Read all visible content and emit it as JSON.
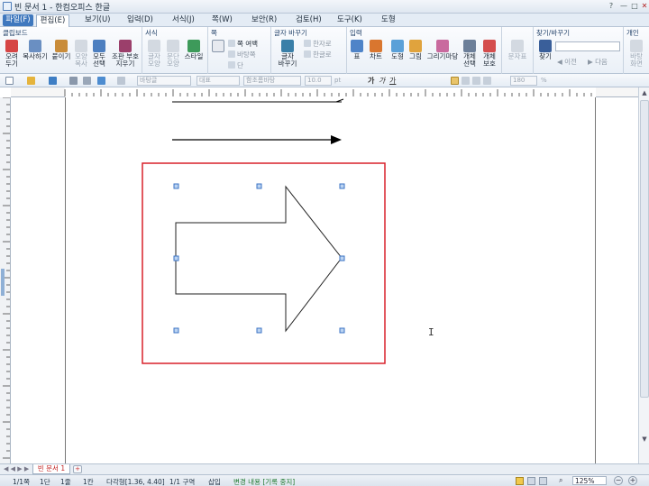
{
  "window": {
    "title": "빈 문서 1 - 한컴오피스 한글",
    "controls": {
      "help": "?",
      "minimize": "—",
      "maximize": "□",
      "close": "✕"
    }
  },
  "menubar": {
    "items": [
      "파일(F)",
      "편집(E)",
      "보기(U)",
      "입력(D)",
      "서식(J)",
      "쪽(W)",
      "보안(R)",
      "검토(H)",
      "도구(K)",
      "도형"
    ],
    "active": "편집(E)"
  },
  "ribbon": {
    "groups": {
      "clipboard": "클립보드",
      "format": "서식",
      "page": "쪽",
      "char_replace": "글자 바꾸기",
      "insert": "입력",
      "find": "찾기/바꾸기",
      "personal": "개인"
    },
    "clipboard_buttons": [
      "오려\n두기",
      "복사하기",
      "붙이기",
      "모양\n복사",
      "모두\n선택",
      "조판 부호\n지우기"
    ],
    "format_buttons": [
      "글자\n모양",
      "문단\n모양",
      "스타일"
    ],
    "page_items": [
      "쪽 여백",
      "바탕쪽",
      "단"
    ],
    "char_replace_buttons": [
      "글자\n바꾸기"
    ],
    "char_replace_items": [
      "한자로",
      "한글로"
    ],
    "insert_buttons": [
      "표",
      "차트",
      "도형",
      "그림",
      "그리기마당",
      "개체\n선택",
      "개체\n보호"
    ],
    "misc_buttons": [
      "문자표"
    ],
    "find_buttons": [
      "찾기"
    ],
    "find_nav": [
      "이전",
      "다음"
    ],
    "personal_buttons": [
      "바탕\n화면"
    ]
  },
  "toolbar": {
    "style": "바탕글",
    "language": "대표",
    "font": "함초롬바탕",
    "font_size": "10.0",
    "size_unit": "pt",
    "char_glyphs": [
      "가",
      "가",
      "가"
    ],
    "zoom": "180",
    "zoom_unit": "%"
  },
  "document": {
    "drawing": "right-arrow-shape",
    "selection_color": "#d8202a"
  },
  "tabs": {
    "doc_tab": "빈 문서 1"
  },
  "statusbar": {
    "page": "1/1쪽",
    "section": "1단",
    "line": "1줄",
    "column": "1칸",
    "object_pos": "다각형[1.36, 4.40]",
    "area": "1/1 구역",
    "mode": "삽입",
    "track": "변경 내용 [기록 중지]",
    "zoom": "125%"
  },
  "colors": {
    "accent": "#3f78be",
    "selection": "#d8202a",
    "handle": "#4a86d6"
  }
}
